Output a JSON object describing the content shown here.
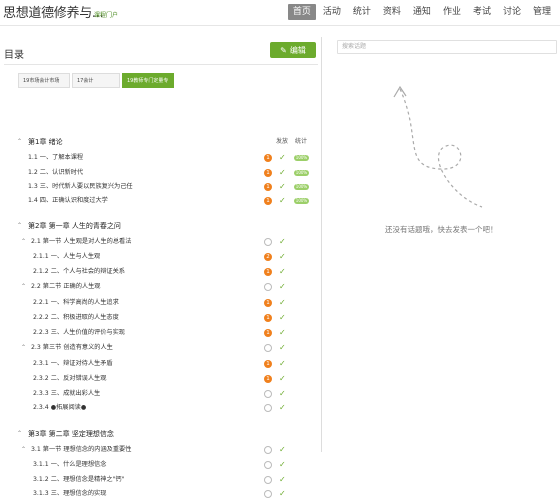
{
  "header": {
    "course_title": "思想道德修养与...",
    "portal_link": "课程门户",
    "nav": [
      {
        "label": "首页",
        "active": true
      },
      {
        "label": "活动",
        "active": false
      },
      {
        "label": "统计",
        "active": false
      },
      {
        "label": "资料",
        "active": false
      },
      {
        "label": "通知",
        "active": false
      },
      {
        "label": "作业",
        "active": false
      },
      {
        "label": "考试",
        "active": false
      },
      {
        "label": "讨论",
        "active": false
      },
      {
        "label": "管理",
        "active": false
      }
    ]
  },
  "catalog": {
    "title": "目录",
    "edit_label": "编辑",
    "tabs": [
      "19市场会计市场",
      "17会计",
      "19教师专门定量专"
    ],
    "col_release": "发放",
    "col_stats": "统计",
    "pill_label": "100%",
    "rows": [
      {
        "kind": "ch",
        "text": "第1章 绪论",
        "caret": "^",
        "status": "head"
      },
      {
        "kind": "item",
        "text": "1.1  一、了解本课程",
        "status": "full",
        "badge": "1"
      },
      {
        "kind": "item",
        "text": "1.2  二、认识新时代",
        "status": "full",
        "badge": "1"
      },
      {
        "kind": "item",
        "text": "1.3  三、时代新人要以民族复兴为己任",
        "status": "full",
        "badge": "1"
      },
      {
        "kind": "item",
        "text": "1.4  四、正确认识和度过大学",
        "status": "full",
        "badge": "1"
      },
      {
        "kind": "ch",
        "text": "第2章 第一章 人生的青春之问",
        "caret": "^",
        "status": "none"
      },
      {
        "kind": "sec",
        "text": "2.1  第一节 人生观是对人生的总看法",
        "caret": "^",
        "status": "ring"
      },
      {
        "kind": "item2",
        "text": "2.1.1 一、人生与人生观",
        "status": "badge",
        "badge": "2"
      },
      {
        "kind": "item2",
        "text": "2.1.2 二、个人与社会的辩证关系",
        "status": "badge",
        "badge": "1"
      },
      {
        "kind": "sec",
        "text": "2.2  第二节 正确的人生观",
        "caret": "^",
        "status": "ring"
      },
      {
        "kind": "item2",
        "text": "2.2.1 一、科学高尚的人生追求",
        "status": "badge",
        "badge": "1"
      },
      {
        "kind": "item2",
        "text": "2.2.2 二、积极进取的人生态度",
        "status": "badge",
        "badge": "1"
      },
      {
        "kind": "item2",
        "text": "2.2.3 三、人生价值的评价与实现",
        "status": "badge",
        "badge": "1"
      },
      {
        "kind": "sec",
        "text": "2.3  第三节 创造有意义的人生",
        "caret": "^",
        "status": "ring"
      },
      {
        "kind": "item2",
        "text": "2.3.1 一、辩证对待人生矛盾",
        "status": "badge",
        "badge": "1"
      },
      {
        "kind": "item2",
        "text": "2.3.2 二、反对错误人生观",
        "status": "badge",
        "badge": "1"
      },
      {
        "kind": "item2",
        "text": "2.3.3 三、成就出彩人生",
        "status": "ring"
      },
      {
        "kind": "item2",
        "text": "2.3.4 ●拓展阅读●",
        "status": "ring"
      },
      {
        "kind": "ch",
        "text": "第3章 第二章 坚定理想信念",
        "caret": "^",
        "status": "none"
      },
      {
        "kind": "sec",
        "text": "3.1  第一节 理想信念的内涵及重要性",
        "caret": "^",
        "status": "ring"
      },
      {
        "kind": "item2",
        "text": "3.1.1 一、什么是理想信念",
        "status": "ring"
      },
      {
        "kind": "item2",
        "text": "3.1.2 二、理想信念是精神之\"钙\"",
        "status": "ring"
      },
      {
        "kind": "item2",
        "text": "3.1.3 三、理想信念的实现",
        "status": "ring"
      }
    ]
  },
  "discussion": {
    "search_placeholder": "搜索话题",
    "empty_message": "还没有话题哦，快去发表一个吧！"
  },
  "colors": {
    "accent": "#6cab2d",
    "badge": "#f0801d",
    "pill": "#9ccf69",
    "nav_active": "#888888"
  }
}
